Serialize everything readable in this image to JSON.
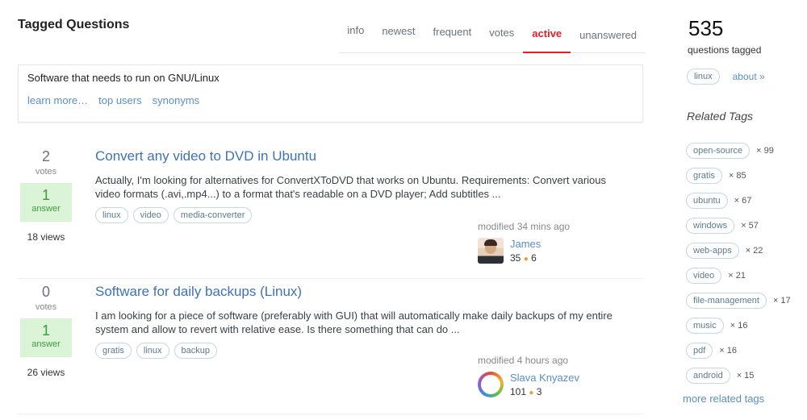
{
  "header": {
    "title": "Tagged Questions"
  },
  "tabs": [
    "info",
    "newest",
    "frequent",
    "votes",
    "active",
    "unanswered"
  ],
  "info_box": {
    "text": "Software that needs to run on GNU/Linux",
    "links": [
      "learn more…",
      "top users",
      "synonyms"
    ]
  },
  "questions": [
    {
      "votes": "2",
      "votes_label": "votes",
      "answers": "1",
      "answers_label": "answer",
      "views": "18 views",
      "title": "Convert any video to DVD in Ubuntu",
      "excerpt": "Actually, I'm looking for alternatives for ConvertXToDVD that works on Ubuntu. Requirements: Convert various video formats (.avi,.mp4...) to a format that's readable on a DVD player; Add subtitles ...",
      "tags": [
        "linux",
        "video",
        "media-converter"
      ],
      "modified": "modified 34 mins ago",
      "user": {
        "name": "James",
        "rep": "35",
        "badges": "6"
      }
    },
    {
      "votes": "0",
      "votes_label": "votes",
      "answers": "1",
      "answers_label": "answer",
      "views": "26 views",
      "title": "Software for daily backups (Linux)",
      "excerpt": "I am looking for a piece of software (preferably with GUI) that will automatically make daily backups of my entire system and allow to revert with relative ease. Is there something that can do ...",
      "tags": [
        "gratis",
        "linux",
        "backup"
      ],
      "modified": "modified 4 hours ago",
      "user": {
        "name": "Slava Knyazev",
        "rep": "101",
        "badges": "3"
      }
    }
  ],
  "sidebar": {
    "count": "535",
    "count_label": "questions tagged",
    "tag": "linux",
    "about": "about »",
    "related_title": "Related Tags",
    "related": [
      {
        "tag": "open-source",
        "count": "× 99"
      },
      {
        "tag": "gratis",
        "count": "× 85"
      },
      {
        "tag": "ubuntu",
        "count": "× 67"
      },
      {
        "tag": "windows",
        "count": "× 57"
      },
      {
        "tag": "web-apps",
        "count": "× 22"
      },
      {
        "tag": "video",
        "count": "× 21"
      },
      {
        "tag": "file-management",
        "count": "× 17"
      },
      {
        "tag": "music",
        "count": "× 16"
      },
      {
        "tag": "pdf",
        "count": "× 16"
      },
      {
        "tag": "android",
        "count": "× 15"
      }
    ],
    "more": "more related tags"
  },
  "colors": {
    "accent": "#e0202a",
    "link": "#3e72b8",
    "answer_bg": "#dbf4d8"
  }
}
